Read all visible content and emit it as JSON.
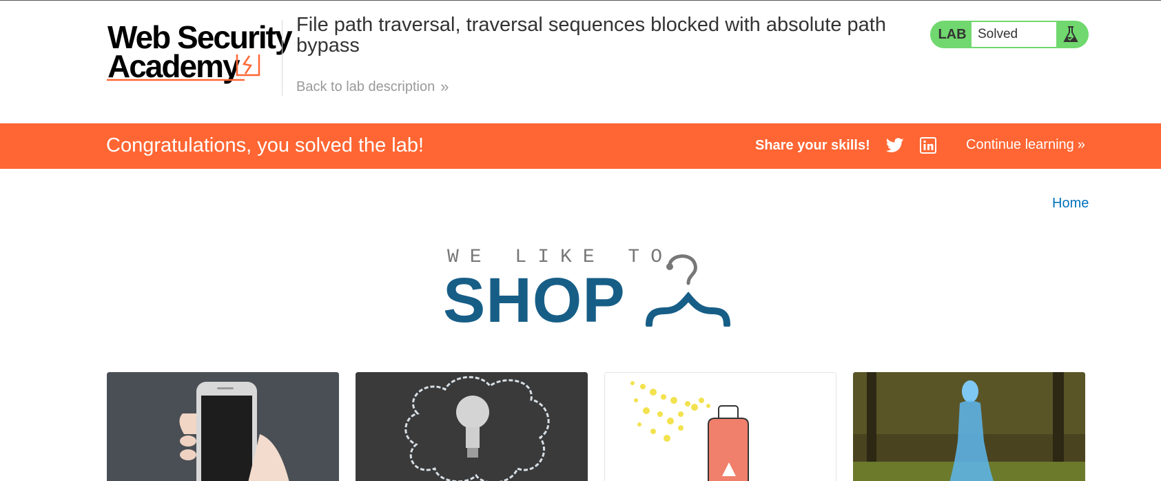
{
  "header": {
    "logo": {
      "line1": "Web Security",
      "line2": "Academy"
    },
    "lab_title": "File path traversal, traversal sequences blocked with absolute path bypass",
    "back_link": "Back to lab description",
    "lab_status": {
      "tag": "LAB",
      "value": "Solved",
      "icon": "flask-icon"
    }
  },
  "banner": {
    "message": "Congratulations, you solved the lab!",
    "share_label": "Share your skills!",
    "social_icons": [
      "twitter-icon",
      "linkedin-icon"
    ],
    "continue_label": "Continue learning",
    "color": "#ff6633"
  },
  "nav": {
    "home": "Home"
  },
  "shop_logo": {
    "tagline": "WE LIKE TO",
    "word": "SHOP",
    "color": "#175e87"
  },
  "products": [
    {
      "image": "phone-in-hand"
    },
    {
      "image": "lightbulb-chalk-cloud"
    },
    {
      "image": "spray-can"
    },
    {
      "image": "hologram-woman-in-park"
    }
  ],
  "colors": {
    "accent": "#ff6633",
    "status_green": "#70d86e",
    "link": "#0071bc",
    "brand_blue": "#175e87"
  }
}
